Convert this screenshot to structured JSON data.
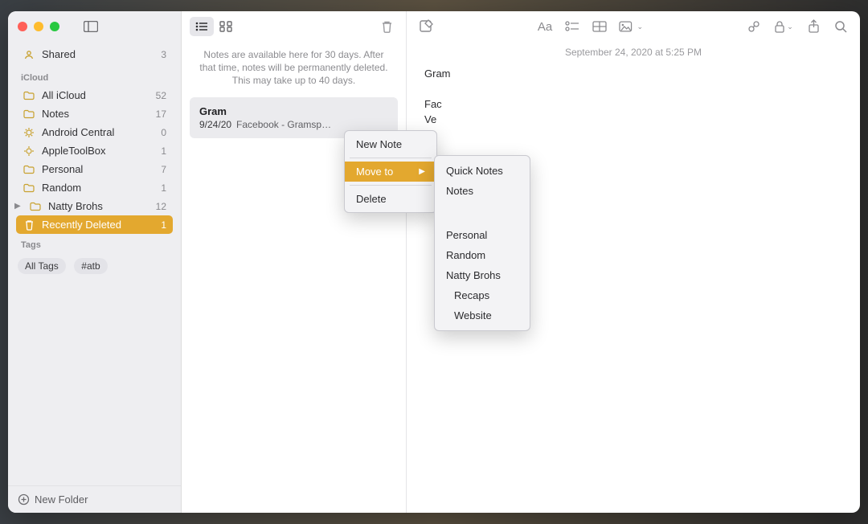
{
  "sidebar": {
    "shared": {
      "label": "Shared",
      "count": "3"
    },
    "sections": [
      {
        "heading": "iCloud",
        "items": [
          {
            "icon": "folder",
            "label": "All iCloud",
            "count": "52"
          },
          {
            "icon": "folder",
            "label": "Notes",
            "count": "17"
          },
          {
            "icon": "gear",
            "label": "Android Central",
            "count": "0"
          },
          {
            "icon": "gear",
            "label": "AppleToolBox",
            "count": "1"
          },
          {
            "icon": "folder",
            "label": "Personal",
            "count": "7"
          },
          {
            "icon": "folder",
            "label": "Random",
            "count": "1"
          },
          {
            "icon": "folder",
            "label": "Natty Brohs",
            "count": "12",
            "disclosure": true
          },
          {
            "icon": "trash",
            "label": "Recently Deleted",
            "count": "1",
            "selected": true
          }
        ]
      }
    ],
    "tags_heading": "Tags",
    "tags": [
      "All Tags",
      "#atb"
    ],
    "new_folder": "New Folder"
  },
  "list": {
    "deleted_info": "Notes are available here for 30 days. After that time, notes will be permanently deleted. This may take up to 40 days.",
    "note": {
      "title": "Gram",
      "date": "9/24/20",
      "preview": "Facebook - Gramsp…"
    }
  },
  "editor": {
    "timestamp": "September 24, 2020 at 5:25 PM",
    "title": "Gram",
    "body_lines": [
      "Fac",
      "Ve"
    ]
  },
  "context_menu_1": {
    "new_note": "New Note",
    "move_to": "Move to",
    "delete": "Delete"
  },
  "context_menu_2": {
    "items_top": [
      "Quick Notes",
      "Notes"
    ],
    "items_bottom": [
      "Personal",
      "Random",
      "Natty Brohs"
    ],
    "items_nested": [
      "Recaps",
      "Website"
    ]
  }
}
